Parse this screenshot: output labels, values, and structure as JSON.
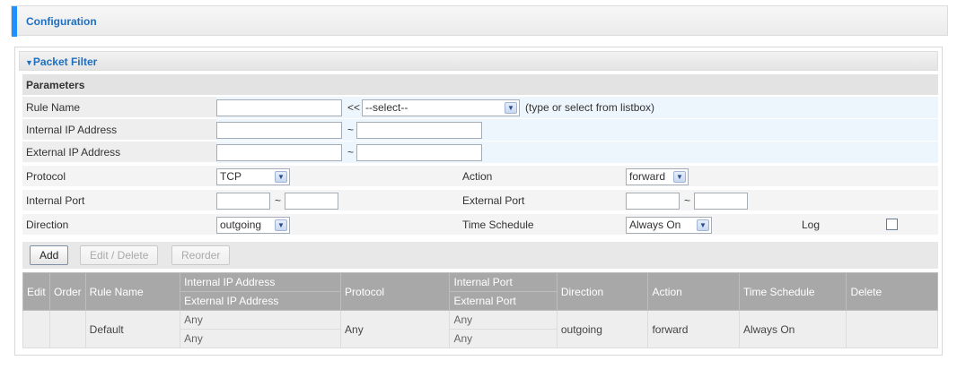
{
  "header": {
    "title": "Configuration"
  },
  "panel": {
    "title": "Packet Filter",
    "section": "Parameters"
  },
  "form": {
    "rule_name": {
      "label": "Rule Name",
      "value": "",
      "arrows": "<<",
      "select": "--select--",
      "hint": "(type or select from listbox)"
    },
    "internal_ip": {
      "label": "Internal IP Address",
      "from": "",
      "to": "",
      "sep": "~"
    },
    "external_ip": {
      "label": "External IP Address",
      "from": "",
      "to": "",
      "sep": "~"
    },
    "protocol": {
      "label": "Protocol",
      "value": "TCP"
    },
    "action": {
      "label": "Action",
      "value": "forward"
    },
    "internal_port": {
      "label": "Internal Port",
      "from": "",
      "to": "",
      "sep": "~"
    },
    "external_port": {
      "label": "External Port",
      "from": "",
      "to": "",
      "sep": "~"
    },
    "direction": {
      "label": "Direction",
      "value": "outgoing"
    },
    "time_schedule": {
      "label": "Time Schedule",
      "value": "Always On"
    },
    "log": {
      "label": "Log",
      "checked": false
    }
  },
  "buttons": {
    "add": "Add",
    "edit_delete": "Edit / Delete",
    "reorder": "Reorder"
  },
  "table": {
    "headers": {
      "edit": "Edit",
      "order": "Order",
      "rule_name": "Rule Name",
      "internal_ip": "Internal IP Address",
      "external_ip": "External IP Address",
      "protocol": "Protocol",
      "internal_port": "Internal Port",
      "external_port": "External Port",
      "direction": "Direction",
      "action": "Action",
      "time_schedule": "Time Schedule",
      "delete": "Delete"
    },
    "rows": [
      {
        "edit": "",
        "order": "",
        "rule_name": "Default",
        "internal_ip": "Any",
        "external_ip": "Any",
        "protocol": "Any",
        "internal_port": "Any",
        "external_port": "Any",
        "direction": "outgoing",
        "action": "forward",
        "time_schedule": "Always On",
        "delete": ""
      }
    ]
  },
  "icons": {
    "collapse": "triangle-down-icon",
    "dropdown": "chevron-down-icon"
  },
  "colors": {
    "accent": "#1e90ff",
    "title": "#1e6fbf",
    "table_header": "#a8a8a8"
  }
}
